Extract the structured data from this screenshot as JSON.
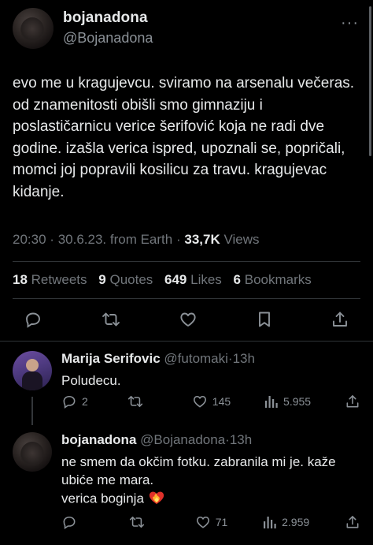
{
  "main_tweet": {
    "display_name": "bojanadona",
    "handle": "@Bojanadona",
    "more_glyph": "···",
    "text": "evo me u kragujevcu. sviramo na arsenalu večeras. od znamenitosti obišli smo gimnaziju i poslastičarnicu verice šerifović koja ne radi dve godine. izašla verica ispred, upoznali se, popričali, momci joj popravili kosilicu za travu. kragujevac kidanje.",
    "time": "20:30",
    "date": "30.6.23.",
    "source": "from Earth",
    "separator": "·",
    "views_count": "33,7K",
    "views_label": "Views",
    "stats": {
      "retweets_count": "18",
      "retweets_label": "Retweets",
      "quotes_count": "9",
      "quotes_label": "Quotes",
      "likes_count": "649",
      "likes_label": "Likes",
      "bookmarks_count": "6",
      "bookmarks_label": "Bookmarks"
    },
    "actions": [
      "reply-icon",
      "retweet-icon",
      "like-icon",
      "bookmark-icon",
      "share-icon"
    ]
  },
  "replies": [
    {
      "display_name": "Marija Serifovic",
      "handle": "@futomaki",
      "separator": "·",
      "time": "13h",
      "text": "Poludecu.",
      "reply_count": "2",
      "retweet_count": "",
      "like_count": "145",
      "view_count": "5.955"
    },
    {
      "display_name": "bojanadona",
      "handle": "@Bojanadona",
      "separator": "·",
      "time": "13h",
      "text_line1": "ne smem da okčim fotku. zabranila mi je. kaže ubiće me mara.",
      "text_line2": "verica boginja",
      "emoji": "heart-on-fire",
      "reply_count": "",
      "retweet_count": "",
      "like_count": "71",
      "view_count": "2.959"
    }
  ],
  "colors": {
    "background": "#000000",
    "text": "#e7e9ea",
    "muted": "#71767b",
    "divider": "#2f3336"
  }
}
